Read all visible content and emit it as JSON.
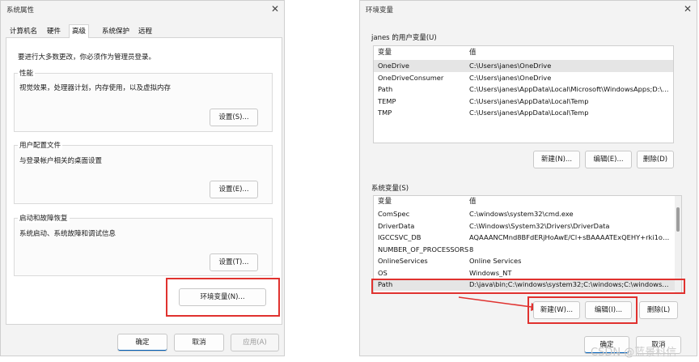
{
  "left_window": {
    "title": "系统属性",
    "tabs": [
      "计算机名",
      "硬件",
      "高级",
      "系统保护",
      "远程"
    ],
    "notice": "要进行大多数更改，你必须作为管理员登录。",
    "performance": {
      "label": "性能",
      "text": "视觉效果，处理器计划，内存使用，以及虚拟内存",
      "button": "设置(S)..."
    },
    "profile": {
      "label": "用户配置文件",
      "text": "与登录帐户相关的桌面设置",
      "button": "设置(E)..."
    },
    "startup": {
      "label": "启动和故障恢复",
      "text": "系统启动、系统故障和调试信息",
      "button": "设置(T)..."
    },
    "env_button": "环境变量(N)...",
    "ok": "确定",
    "cancel": "取消",
    "apply": "应用(A)"
  },
  "right_window": {
    "title": "环境变量",
    "user_section": {
      "label": "janes 的用户变量(U)",
      "col_var": "变量",
      "col_val": "值",
      "rows": [
        {
          "name": "OneDrive",
          "value": "C:\\Users\\janes\\OneDrive"
        },
        {
          "name": "OneDriveConsumer",
          "value": "C:\\Users\\janes\\OneDrive"
        },
        {
          "name": "Path",
          "value": "C:\\Users\\janes\\AppData\\Local\\Microsoft\\WindowsApps;D:\\M..."
        },
        {
          "name": "TEMP",
          "value": "C:\\Users\\janes\\AppData\\Local\\Temp"
        },
        {
          "name": "TMP",
          "value": "C:\\Users\\janes\\AppData\\Local\\Temp"
        }
      ],
      "new": "新建(N)...",
      "edit": "编辑(E)...",
      "delete": "删除(D)"
    },
    "system_section": {
      "label": "系统变量(S)",
      "col_var": "变量",
      "col_val": "值",
      "rows": [
        {
          "name": "ComSpec",
          "value": "C:\\windows\\system32\\cmd.exe"
        },
        {
          "name": "DriverData",
          "value": "C:\\Windows\\System32\\Drivers\\DriverData"
        },
        {
          "name": "IGCCSVC_DB",
          "value": "AQAAANCMnd8BFdERjHoAwE/Cl+sBAAAATExQEHY+rki1oD4..."
        },
        {
          "name": "NUMBER_OF_PROCESSORS",
          "value": "8"
        },
        {
          "name": "OnlineServices",
          "value": "Online Services"
        },
        {
          "name": "OS",
          "value": "Windows_NT"
        },
        {
          "name": "Path",
          "value": "D:\\java\\bin;C:\\windows\\system32;C:\\windows;C:\\windows\\Syst..."
        }
      ],
      "new": "新建(W)...",
      "edit": "编辑(I)...",
      "delete": "删除(L)"
    },
    "ok": "确定",
    "cancel": "取消"
  },
  "watermark": "CSDN @蓝景科信",
  "colors": {
    "highlight_red": "#e0322f",
    "accent_blue": "#005fb8"
  }
}
